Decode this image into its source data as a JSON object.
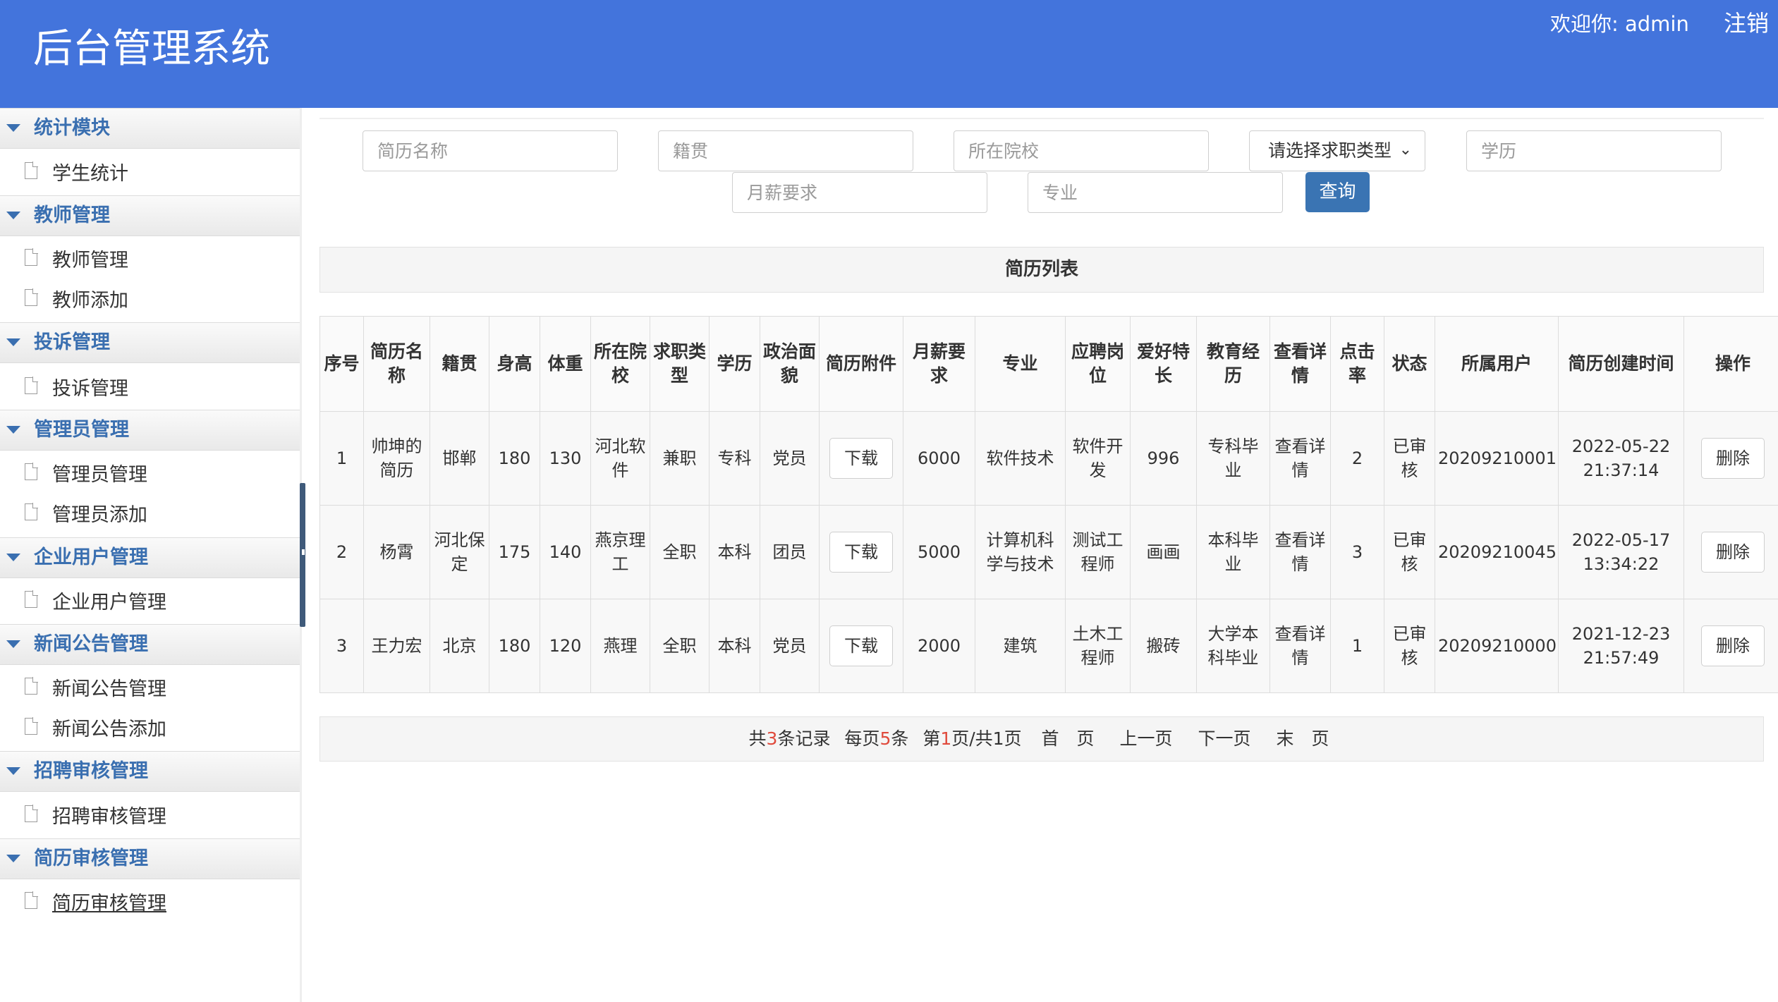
{
  "header": {
    "title": "后台管理系统",
    "welcome": "欢迎你: admin",
    "logout": "注销"
  },
  "sidebar": {
    "sections": [
      {
        "label": "统计模块",
        "items": [
          "学生统计"
        ]
      },
      {
        "label": "教师管理",
        "items": [
          "教师管理",
          "教师添加"
        ]
      },
      {
        "label": "投诉管理",
        "items": [
          "投诉管理"
        ]
      },
      {
        "label": "管理员管理",
        "items": [
          "管理员管理",
          "管理员添加"
        ]
      },
      {
        "label": "企业用户管理",
        "items": [
          "企业用户管理"
        ]
      },
      {
        "label": "新闻公告管理",
        "items": [
          "新闻公告管理",
          "新闻公告添加"
        ]
      },
      {
        "label": "招聘审核管理",
        "items": [
          "招聘审核管理"
        ]
      },
      {
        "label": "简历审核管理",
        "items": [
          "简历审核管理"
        ]
      }
    ]
  },
  "search": {
    "resume_name_placeholder": "简历名称",
    "hometown_placeholder": "籍贯",
    "school_placeholder": "所在院校",
    "job_type_select": "请选择求职类型",
    "education_placeholder": "学历",
    "salary_placeholder": "月薪要求",
    "major_placeholder": "专业",
    "query_button": "查询"
  },
  "table": {
    "title": "简历列表",
    "headers": [
      "序号",
      "简历名称",
      "籍贯",
      "身高",
      "体重",
      "所在院校",
      "求职类型",
      "学历",
      "政治面貌",
      "简历附件",
      "月薪要求",
      "专业",
      "应聘岗位",
      "爱好特长",
      "教育经历",
      "查看详情",
      "点击率",
      "状态",
      "所属用户",
      "简历创建时间",
      "操作"
    ],
    "rows": [
      {
        "no": "1",
        "name": "帅坤的简历",
        "hometown": "邯郸",
        "height": "180",
        "weight": "130",
        "school": "河北软件",
        "job_type": "兼职",
        "education": "专科",
        "political": "党员",
        "attachment": "下载",
        "salary": "6000",
        "major": "软件技术",
        "position": "软件开发",
        "hobby": "996",
        "edu_exp": "专科毕业",
        "detail": "查看详情",
        "clicks": "2",
        "status": "已审核",
        "user": "20209210001",
        "created": "2022-05-22 21:37:14",
        "action": "删除"
      },
      {
        "no": "2",
        "name": "杨霄",
        "hometown": "河北保定",
        "height": "175",
        "weight": "140",
        "school": "燕京理工",
        "job_type": "全职",
        "education": "本科",
        "political": "团员",
        "attachment": "下载",
        "salary": "5000",
        "major": "计算机科学与技术",
        "position": "测试工程师",
        "hobby": "画画",
        "edu_exp": "本科毕业",
        "detail": "查看详情",
        "clicks": "3",
        "status": "已审核",
        "user": "20209210045",
        "created": "2022-05-17 13:34:22",
        "action": "删除"
      },
      {
        "no": "3",
        "name": "王力宏",
        "hometown": "北京",
        "height": "180",
        "weight": "120",
        "school": "燕理",
        "job_type": "全职",
        "education": "本科",
        "political": "党员",
        "attachment": "下载",
        "salary": "2000",
        "major": "建筑",
        "position": "土木工程师",
        "hobby": "搬砖",
        "edu_exp": "大学本科毕业",
        "detail": "查看详情",
        "clicks": "1",
        "status": "已审核",
        "user": "20209210000",
        "created": "2021-12-23 21:57:49",
        "action": "删除"
      }
    ]
  },
  "pagination": {
    "total_prefix": "共",
    "total_count": "3",
    "total_suffix": "条记录",
    "per_page_prefix": "每页",
    "per_page": "5",
    "per_page_suffix": "条",
    "page_prefix": "第",
    "current_page": "1",
    "page_suffix": "页/共1页",
    "first": "首　页",
    "prev": "上一页",
    "next": "下一页",
    "last": "末　页"
  },
  "colors": {
    "header_bg": "#4374dc",
    "section_text": "#3a6fb0",
    "query_button": "#3a74b3",
    "highlight_number": "#e04a3c"
  }
}
